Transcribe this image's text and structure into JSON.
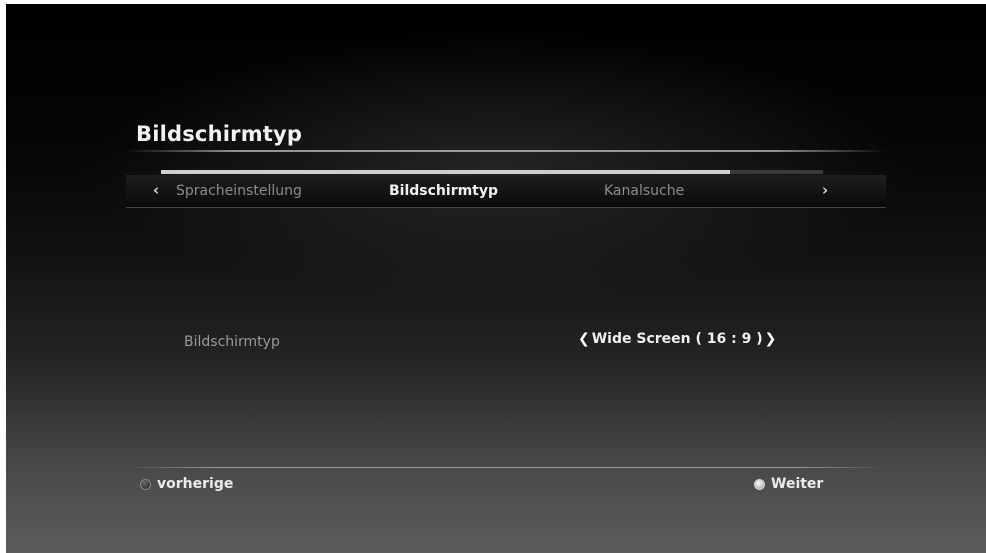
{
  "page": {
    "title": "Bildschirmtyp"
  },
  "wizard": {
    "progress_fraction": 0.86,
    "prev_arrow": "‹",
    "next_arrow": "›",
    "steps": [
      {
        "label": "Spracheinstellung",
        "state": "previous"
      },
      {
        "label": "Bildschirmtyp",
        "state": "current"
      },
      {
        "label": "Kanalsuche",
        "state": "next"
      }
    ]
  },
  "setting": {
    "label": "Bildschirmtyp",
    "left_arrow": "❮",
    "value": "Wide Screen ( 16 : 9 )",
    "right_arrow": "❯"
  },
  "footer": {
    "back_label": "vorherige",
    "next_label": "Weiter"
  },
  "colors": {
    "text_primary": "#f0f0f0",
    "text_muted": "#8c8c8c",
    "progress_fill": "#cfcfcf",
    "progress_track": "#3a3a3a"
  },
  "icons": {
    "back": "dark-round-button-icon",
    "next": "light-round-button-icon"
  }
}
